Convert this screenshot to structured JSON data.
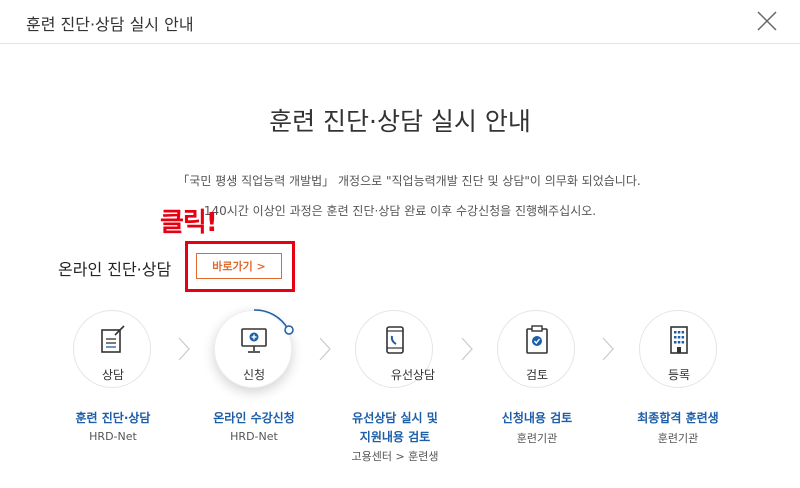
{
  "header": {
    "title": "훈련 진단·상담 실시 안내"
  },
  "main": {
    "title": "훈련 진단·상담 실시 안내",
    "desc1": "「국민 평생 직업능력 개발법」 개정으로 \"직업능력개발 진단 및 상담\"이 의무화 되었습니다.",
    "desc2": "140시간 이상인 과정은 훈련 진단·상담 완료 이후 수강신청을 진행해주십시오."
  },
  "annotation": {
    "text": "클릭!",
    "color": "#e60012"
  },
  "online": {
    "label": "온라인 진단·상담",
    "button": "바로가기  >"
  },
  "steps": [
    {
      "circle": "상담",
      "icon": "document-edit-icon",
      "title": "훈련 진단·상담",
      "sub": "HRD-Net"
    },
    {
      "circle": "신청",
      "icon": "monitor-plus-icon",
      "title": "온라인 수강신청",
      "sub": "HRD-Net"
    },
    {
      "circle": "유선상담",
      "icon": "phone-icon",
      "title": "유선상담 실시 및",
      "title2": "지원내용 검토",
      "sub": "고용센터 > 훈련생"
    },
    {
      "circle": "검토",
      "icon": "clipboard-check-icon",
      "title": "신청내용 검토",
      "sub": "훈련기관"
    },
    {
      "circle": "등록",
      "icon": "building-icon",
      "title": "최종합격 훈련생",
      "sub": "훈련기관"
    }
  ],
  "colors": {
    "accent": "#1d5ea8",
    "button": "#e06a2c",
    "highlight": "#e60012"
  }
}
